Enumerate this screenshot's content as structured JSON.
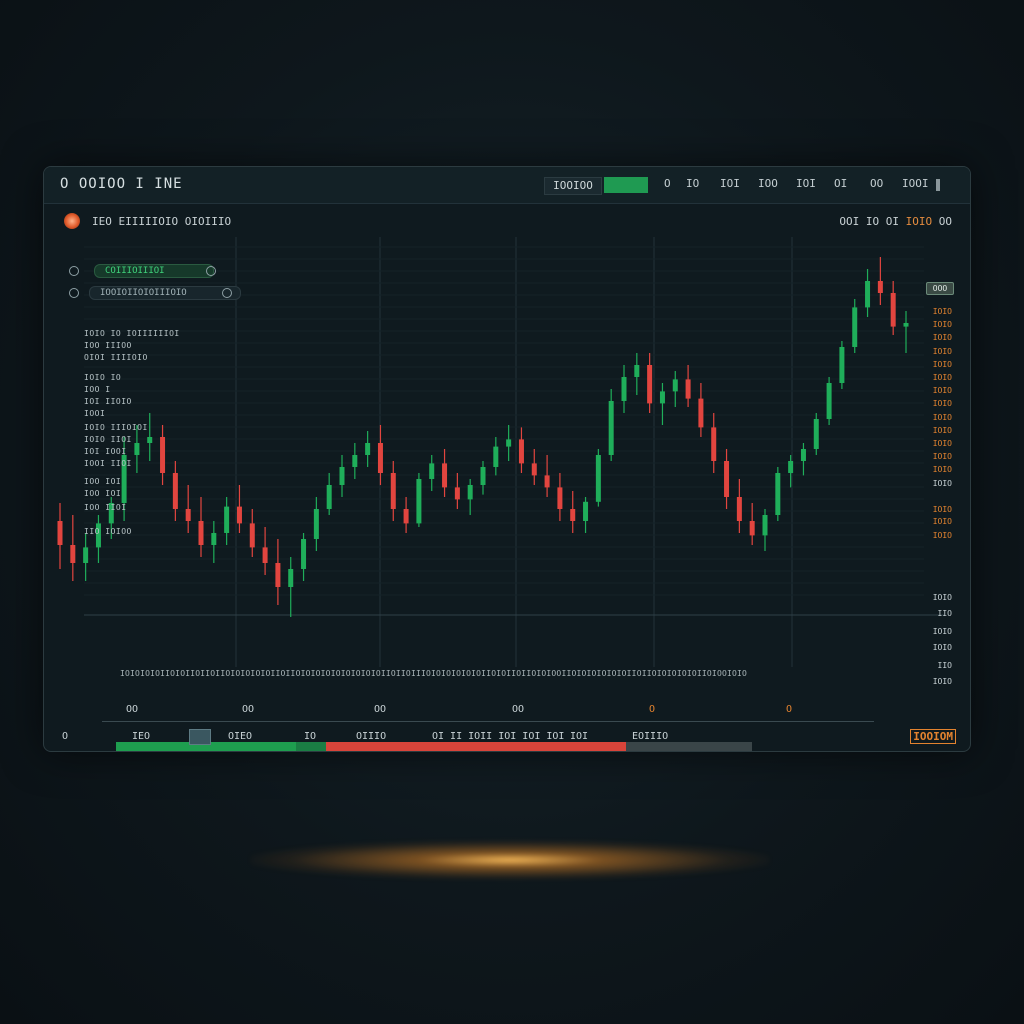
{
  "titlebar": {
    "app_title": "O OOIOO I INE",
    "field_value": "IOOIOO",
    "buttons": [
      "O",
      "IO",
      "IOI",
      "IOO",
      "IOI",
      "OI",
      "OO",
      "IOOI"
    ]
  },
  "symbol": {
    "label": "IEO EIIIIIOIO OIOIIIO",
    "ohlc_left": "OOI IO",
    "ohlc_mid": "OI",
    "ohlc_hl": "IOIO",
    "ohlc_right": "OO"
  },
  "indicators": {
    "pill1": "COIIIOIIIOI",
    "pill2": "IOOIOIIOIOIIIOIO"
  },
  "legend_lines": [
    "IOIO IO IOIIIIIIOI",
    "IOO IIIOO",
    "OIOI IIIIOIO",
    "IOIO IO",
    "IOO I",
    "IOI IIOIO",
    "IOOI",
    "IOIO IIIOIOI",
    "IOIO IIOI",
    "IOI IOOI",
    "IOOI IIOI",
    "IOO IOI",
    "IOO IOI",
    "IOO IIOI",
    "IIO IOIOO"
  ],
  "right_axis": {
    "badge": "OOO",
    "orange": [
      "IOIO",
      "IOIO",
      "IOIO",
      "IOIO",
      "IOIO",
      "IOIO",
      "IOIO",
      "IOIO",
      "IOIO",
      "IOIO",
      "IOIO",
      "IOIO",
      "IOIO"
    ],
    "white": [
      "IOIO",
      "IOIO",
      "IIO",
      "IOIO",
      "IOIO",
      "IIO",
      "IOIO"
    ],
    "lower_orange": [
      "IOIO",
      "IOIO",
      "IOIO"
    ]
  },
  "ticker_row": "IOIOIOIOIIOIOIIOIIOIIOIOIOIOIOIIOIIOIOIOIOIOIOIOIOIOIIOIIOIIIOIOIOIOIOIOIIOIOIIOIIOIOIOOIIOIOIOIOIOIOIIOIIOIOIOIOIOIIOIOOIOIO",
  "x_ticks": [
    {
      "label": "OO",
      "highlight": false
    },
    {
      "label": "OO",
      "highlight": false
    },
    {
      "label": "OO",
      "highlight": false
    },
    {
      "label": "OO",
      "highlight": false
    },
    {
      "label": "O",
      "highlight": true
    },
    {
      "label": "O",
      "highlight": true
    }
  ],
  "footer": {
    "icon_label": "O",
    "item1": "IEO",
    "item2": "OIEO",
    "item3": "IO",
    "item4": "OIIIO",
    "item5": "OI II IOII IOI IOI IOI",
    "item6": "IOI",
    "item7": "EOIIIO",
    "right_badge": "IOOIOM"
  },
  "colors": {
    "up": "#1fae5a",
    "down": "#e2453f",
    "accent_orange": "#e3832f",
    "background": "#0f1a1f"
  },
  "chart_data": {
    "type": "candlestick",
    "candles": [
      {
        "o": 450,
        "h": 465,
        "l": 410,
        "c": 430
      },
      {
        "o": 430,
        "h": 455,
        "l": 400,
        "c": 415
      },
      {
        "o": 415,
        "h": 440,
        "l": 400,
        "c": 428
      },
      {
        "o": 428,
        "h": 455,
        "l": 415,
        "c": 448
      },
      {
        "o": 448,
        "h": 470,
        "l": 435,
        "c": 465
      },
      {
        "o": 465,
        "h": 520,
        "l": 450,
        "c": 505
      },
      {
        "o": 505,
        "h": 530,
        "l": 490,
        "c": 515
      },
      {
        "o": 515,
        "h": 540,
        "l": 500,
        "c": 520
      },
      {
        "o": 520,
        "h": 530,
        "l": 480,
        "c": 490
      },
      {
        "o": 490,
        "h": 500,
        "l": 450,
        "c": 460
      },
      {
        "o": 460,
        "h": 480,
        "l": 440,
        "c": 450
      },
      {
        "o": 450,
        "h": 470,
        "l": 420,
        "c": 430
      },
      {
        "o": 430,
        "h": 450,
        "l": 415,
        "c": 440
      },
      {
        "o": 440,
        "h": 470,
        "l": 430,
        "c": 462
      },
      {
        "o": 462,
        "h": 480,
        "l": 440,
        "c": 448
      },
      {
        "o": 448,
        "h": 460,
        "l": 420,
        "c": 428
      },
      {
        "o": 428,
        "h": 445,
        "l": 405,
        "c": 415
      },
      {
        "o": 415,
        "h": 435,
        "l": 380,
        "c": 395
      },
      {
        "o": 395,
        "h": 420,
        "l": 370,
        "c": 410
      },
      {
        "o": 410,
        "h": 440,
        "l": 400,
        "c": 435
      },
      {
        "o": 435,
        "h": 470,
        "l": 425,
        "c": 460
      },
      {
        "o": 460,
        "h": 490,
        "l": 455,
        "c": 480
      },
      {
        "o": 480,
        "h": 505,
        "l": 470,
        "c": 495
      },
      {
        "o": 495,
        "h": 515,
        "l": 485,
        "c": 505
      },
      {
        "o": 505,
        "h": 525,
        "l": 495,
        "c": 515
      },
      {
        "o": 515,
        "h": 530,
        "l": 480,
        "c": 490
      },
      {
        "o": 490,
        "h": 500,
        "l": 450,
        "c": 460
      },
      {
        "o": 460,
        "h": 470,
        "l": 440,
        "c": 448
      },
      {
        "o": 448,
        "h": 490,
        "l": 445,
        "c": 485
      },
      {
        "o": 485,
        "h": 505,
        "l": 475,
        "c": 498
      },
      {
        "o": 498,
        "h": 510,
        "l": 470,
        "c": 478
      },
      {
        "o": 478,
        "h": 490,
        "l": 460,
        "c": 468
      },
      {
        "o": 468,
        "h": 485,
        "l": 455,
        "c": 480
      },
      {
        "o": 480,
        "h": 500,
        "l": 472,
        "c": 495
      },
      {
        "o": 495,
        "h": 520,
        "l": 488,
        "c": 512
      },
      {
        "o": 512,
        "h": 530,
        "l": 500,
        "c": 518
      },
      {
        "o": 518,
        "h": 528,
        "l": 490,
        "c": 498
      },
      {
        "o": 498,
        "h": 510,
        "l": 480,
        "c": 488
      },
      {
        "o": 488,
        "h": 505,
        "l": 470,
        "c": 478
      },
      {
        "o": 478,
        "h": 490,
        "l": 450,
        "c": 460
      },
      {
        "o": 460,
        "h": 475,
        "l": 440,
        "c": 450
      },
      {
        "o": 450,
        "h": 470,
        "l": 440,
        "c": 466
      },
      {
        "o": 466,
        "h": 510,
        "l": 462,
        "c": 505
      },
      {
        "o": 505,
        "h": 560,
        "l": 500,
        "c": 550
      },
      {
        "o": 550,
        "h": 580,
        "l": 540,
        "c": 570
      },
      {
        "o": 570,
        "h": 590,
        "l": 555,
        "c": 580
      },
      {
        "o": 580,
        "h": 590,
        "l": 540,
        "c": 548
      },
      {
        "o": 548,
        "h": 565,
        "l": 530,
        "c": 558
      },
      {
        "o": 558,
        "h": 575,
        "l": 545,
        "c": 568
      },
      {
        "o": 568,
        "h": 580,
        "l": 545,
        "c": 552
      },
      {
        "o": 552,
        "h": 565,
        "l": 520,
        "c": 528
      },
      {
        "o": 528,
        "h": 540,
        "l": 490,
        "c": 500
      },
      {
        "o": 500,
        "h": 510,
        "l": 460,
        "c": 470
      },
      {
        "o": 470,
        "h": 485,
        "l": 440,
        "c": 450
      },
      {
        "o": 450,
        "h": 465,
        "l": 430,
        "c": 438
      },
      {
        "o": 438,
        "h": 460,
        "l": 425,
        "c": 455
      },
      {
        "o": 455,
        "h": 495,
        "l": 450,
        "c": 490
      },
      {
        "o": 490,
        "h": 505,
        "l": 478,
        "c": 500
      },
      {
        "o": 500,
        "h": 515,
        "l": 488,
        "c": 510
      },
      {
        "o": 510,
        "h": 540,
        "l": 505,
        "c": 535
      },
      {
        "o": 535,
        "h": 570,
        "l": 530,
        "c": 565
      },
      {
        "o": 565,
        "h": 600,
        "l": 560,
        "c": 595
      },
      {
        "o": 595,
        "h": 635,
        "l": 590,
        "c": 628
      },
      {
        "o": 628,
        "h": 660,
        "l": 620,
        "c": 650
      },
      {
        "o": 650,
        "h": 670,
        "l": 630,
        "c": 640
      },
      {
        "o": 640,
        "h": 650,
        "l": 605,
        "c": 612
      },
      {
        "o": 612,
        "h": 625,
        "l": 590,
        "c": 615
      }
    ]
  }
}
